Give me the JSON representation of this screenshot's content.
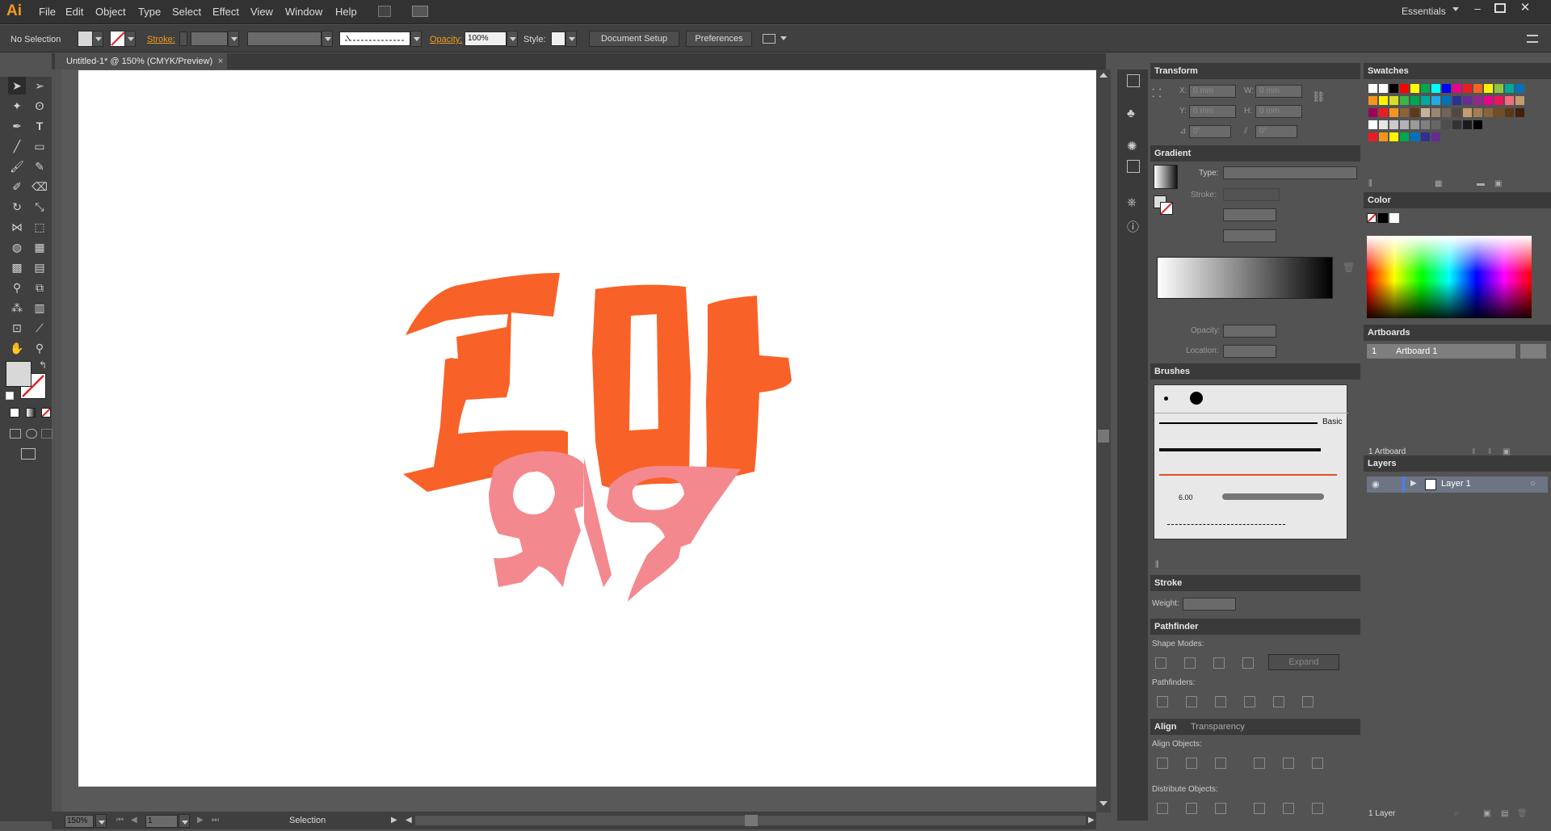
{
  "app": {
    "logo": "Ai",
    "workspace": "Essentials"
  },
  "menu": [
    "File",
    "Edit",
    "Object",
    "Type",
    "Select",
    "Effect",
    "View",
    "Window",
    "Help"
  ],
  "control": {
    "selection": "No Selection",
    "stroke_label": "Stroke:",
    "opacity_label": "Opacity:",
    "opacity_value": "100%",
    "style_label": "Style:",
    "document_setup": "Document Setup",
    "preferences": "Preferences"
  },
  "document": {
    "tab_title": "Untitled-1* @ 150% (CMYK/Preview)",
    "zoom": "150%",
    "artboard_num": "1",
    "status": "Selection"
  },
  "transform": {
    "title": "Transform",
    "x_label": "X:",
    "x": "0 mm",
    "y_label": "Y:",
    "y": "0 mm",
    "w_label": "W:",
    "w": "0 mm",
    "h_label": "H:",
    "h": "0 mm",
    "rot": "0°",
    "shear": "0°"
  },
  "gradient": {
    "title": "Gradient",
    "type_label": "Type:",
    "stroke_label": "Stroke:",
    "opacity_label": "Opacity:",
    "location_label": "Location:"
  },
  "brushes": {
    "title": "Brushes",
    "basic": "Basic",
    "size": "6.00"
  },
  "stroke": {
    "title": "Stroke",
    "weight_label": "Weight:"
  },
  "pathfinder": {
    "title": "Pathfinder",
    "shape_modes": "Shape Modes:",
    "pathfinders": "Pathfinders:",
    "expand": "Expand"
  },
  "align": {
    "title": "Align",
    "tab2": "Transparency",
    "align_objects": "Align Objects:",
    "distribute_objects": "Distribute Objects:"
  },
  "swatches": {
    "title": "Swatches"
  },
  "color": {
    "title": "Color"
  },
  "artboards": {
    "title": "Artboards",
    "row_num": "1",
    "row_name": "Artboard 1",
    "count": "1 Artboard"
  },
  "layers": {
    "title": "Layers",
    "layer_name": "Layer 1",
    "count": "1 Layer"
  },
  "colors": {
    "orange": "#f86228",
    "pink": "#f4888f",
    "accent": "#f29b1d"
  }
}
